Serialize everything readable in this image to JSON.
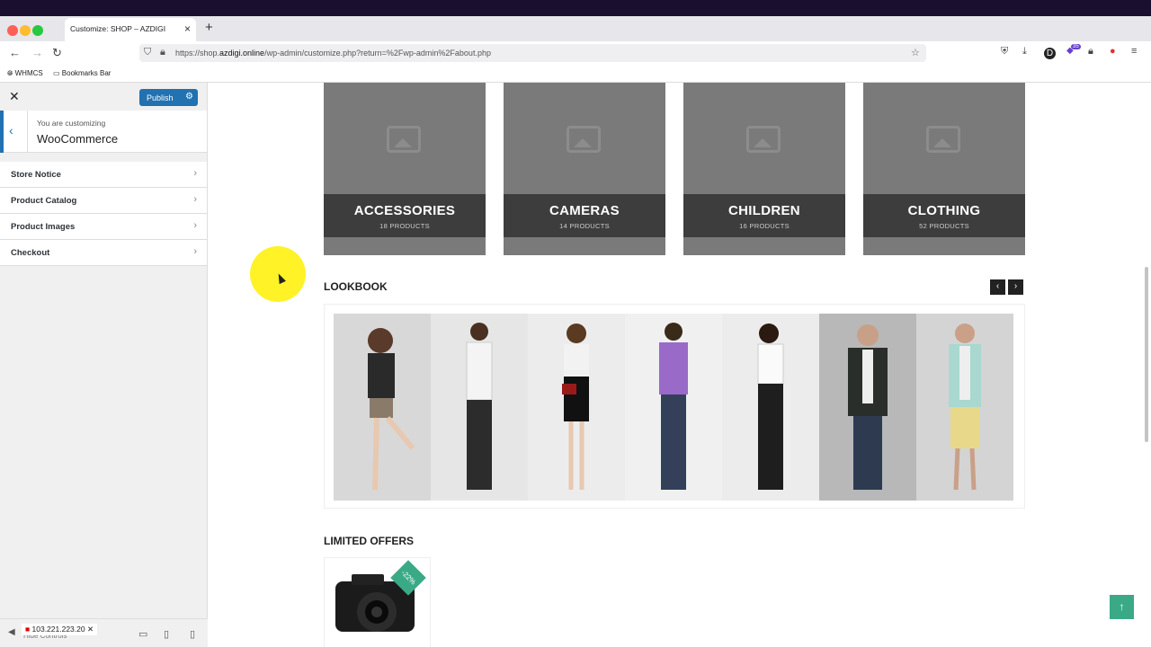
{
  "browser": {
    "tab_title": "Customize: SHOP – AZDIGI",
    "url_prefix": "https://shop.",
    "url_host": "azdigi.online",
    "url_path": "/wp-admin/customize.php?return=%2Fwp-admin%2Fabout.php",
    "bookmarks": [
      "WHMCS",
      "Bookmarks Bar"
    ],
    "extension_badge": "35"
  },
  "customizer": {
    "publish_label": "Publish",
    "customizing_label": "You are customizing",
    "panel_title": "WooCommerce",
    "sections": [
      "Store Notice",
      "Product Catalog",
      "Product Images",
      "Checkout"
    ],
    "ip_address": "103.221.223.20",
    "hide_controls": "Hide Controls"
  },
  "preview": {
    "categories": [
      {
        "name": "ACCESSORIES",
        "count": "18 PRODUCTS"
      },
      {
        "name": "CAMERAS",
        "count": "14 PRODUCTS"
      },
      {
        "name": "CHILDREN",
        "count": "16 PRODUCTS"
      },
      {
        "name": "CLOTHING",
        "count": "52 PRODUCTS"
      }
    ],
    "lookbook_title": "LOOKBOOK",
    "limited_offers_title": "LIMITED OFFERS",
    "discount_badge": "-22%"
  },
  "colors": {
    "accent_blue": "#2271b1",
    "accent_green": "#3aaa86",
    "category_band": "#3d3d3d"
  }
}
